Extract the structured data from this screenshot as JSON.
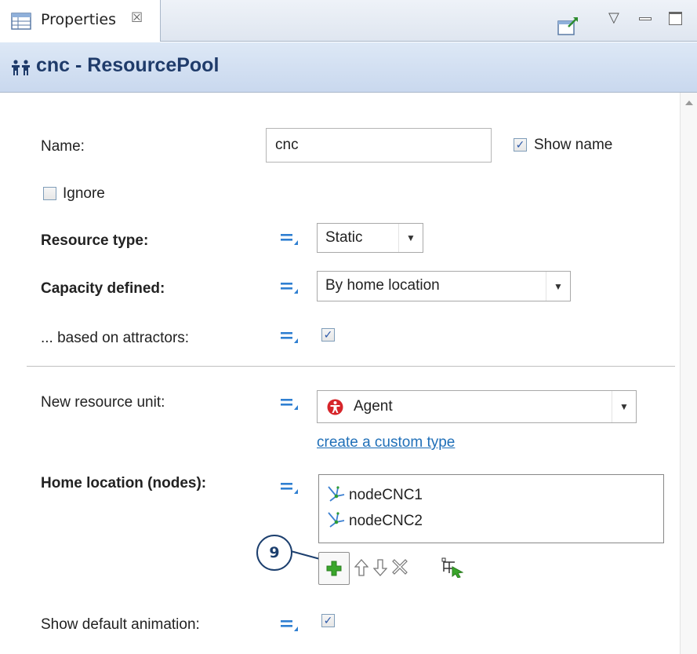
{
  "tab": {
    "label": "Properties",
    "close_glyph": "☒"
  },
  "view_menu": {
    "dropdown_glyph": "▽",
    "minimize_glyph": "▭",
    "maximize_glyph": "▢"
  },
  "header": {
    "title": "cnc - ResourcePool"
  },
  "form": {
    "name_label": "Name:",
    "name_value": "cnc",
    "show_name_label": "Show name",
    "show_name_checked": true,
    "ignore_label": "Ignore",
    "ignore_checked": false,
    "resource_type_label": "Resource type:",
    "resource_type_value": "Static",
    "capacity_label": "Capacity defined:",
    "capacity_value": "By home location",
    "attractors_label": "... based on attractors:",
    "attractors_checked": true,
    "new_unit_label": "New resource unit:",
    "new_unit_value": "Agent",
    "create_link": "create a custom type",
    "home_location_label": "Home location (nodes):",
    "nodes": [
      "nodeCNC1",
      "nodeCNC2"
    ],
    "show_animation_label": "Show default animation:",
    "show_animation_checked": true
  },
  "callout": {
    "number": "9"
  },
  "check_glyph": "✓",
  "colors": {
    "title_text": "#1f3b6a",
    "link": "#1f6fb8",
    "add_green": "#3aa62b",
    "agent_red": "#d6252a",
    "eq_blue": "#2f7fd1",
    "callout_navy": "#1c3f6e"
  },
  "icons": {
    "tab": "properties-table-icon",
    "header": "resource-pool-people-icon",
    "agent": "agent-red-circle-icon",
    "node": "network-node-icon",
    "toolbar": [
      "add-plus-icon",
      "move-up-icon",
      "move-down-icon",
      "remove-icon",
      "select-on-canvas-icon"
    ]
  }
}
